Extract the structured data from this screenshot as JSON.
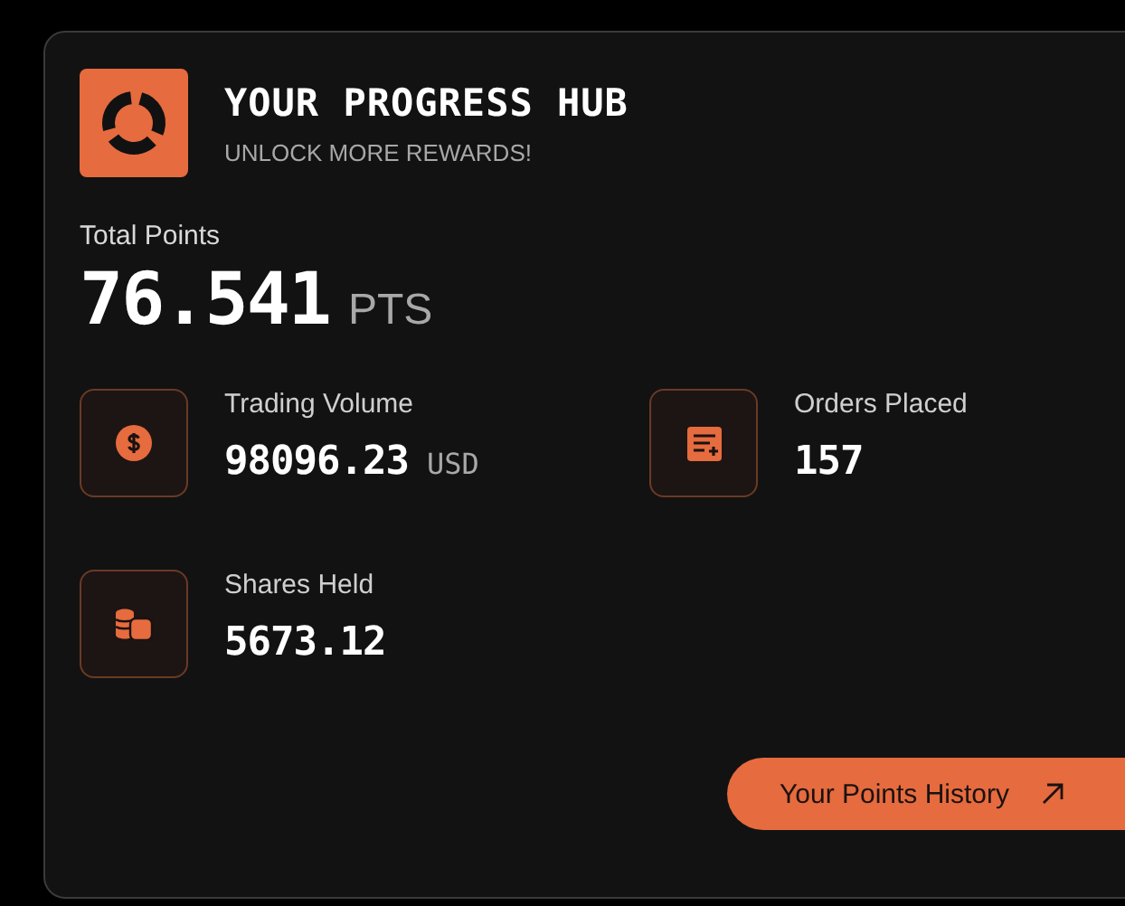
{
  "header": {
    "title": "YOUR PROGRESS HUB",
    "subtitle": "UNLOCK MORE REWARDS!"
  },
  "total": {
    "label": "Total Points",
    "value": "76.541",
    "unit": "PTS"
  },
  "stats": [
    {
      "kind": "dollar",
      "label": "Trading Volume",
      "value": "98096.23",
      "unit": "USD"
    },
    {
      "kind": "orders",
      "label": "Orders Placed",
      "value": "157"
    },
    {
      "kind": "coins",
      "label": "Shares Held",
      "value": "5673.12"
    }
  ],
  "button": {
    "label": "Your Points History"
  }
}
